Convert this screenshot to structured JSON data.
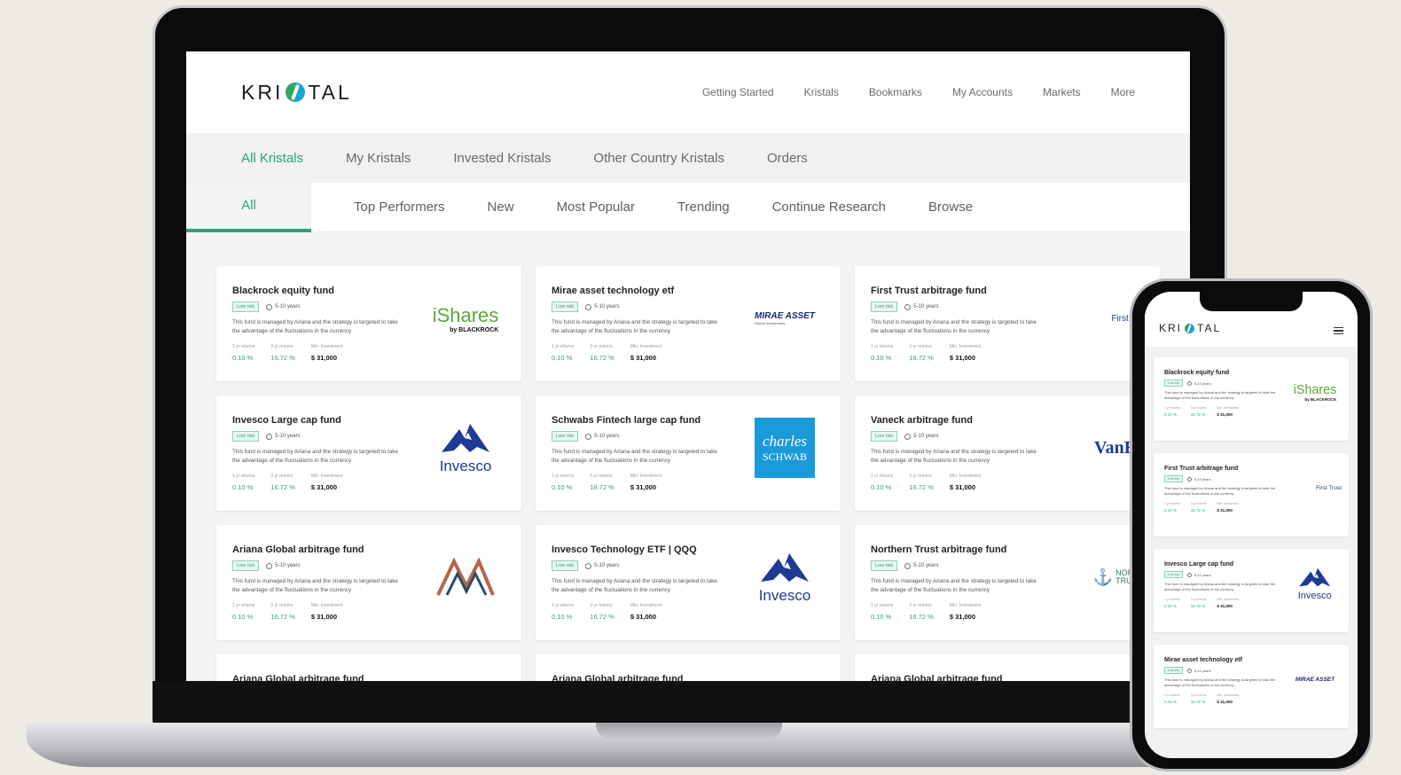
{
  "header": {
    "logo_text_left": "KRI",
    "logo_text_right": "TAL",
    "nav": [
      "Getting Started",
      "Kristals",
      "Bookmarks",
      "My Accounts",
      "Markets",
      "More"
    ]
  },
  "primary_tabs": [
    "All Kristals",
    "My Kristals",
    "Invested Kristals",
    "Other Country Kristals",
    "Orders"
  ],
  "secondary_tabs": [
    "All",
    "Top Performers",
    "New",
    "Most Popular",
    "Trending",
    "Continue Research",
    "Browse"
  ],
  "card_common": {
    "risk": "Low risk",
    "duration": "5-10 years",
    "description": "This fund is managed by Ariana and the strategy is targeted to take the advantage of the fluctuations in the currency",
    "label_1yr": "1 yr returns",
    "label_3yr": "3 yr returns",
    "label_min": "Min. Investment",
    "value_1yr": "0.10 %",
    "value_3yr": "16.72 %",
    "value_min": "$ 31,000"
  },
  "cards": [
    {
      "title": "Blackrock equity fund",
      "brand": "iShares",
      "brand_sub": "by BLACKROCK"
    },
    {
      "title": "Mirae asset technology etf",
      "brand": "MIRAE ASSET",
      "brand_sub": "Global Investments"
    },
    {
      "title": "First Trust arbitrage fund",
      "brand": "First Tru",
      "brand_sub": ""
    },
    {
      "title": "Invesco Large cap fund",
      "brand": "Invesco",
      "brand_sub": ""
    },
    {
      "title": "Schwabs Fintech large cap fund",
      "brand": "charles",
      "brand_sub": "SCHWAB"
    },
    {
      "title": "Vaneck arbitrage fund",
      "brand": "VanEc",
      "brand_sub": ""
    },
    {
      "title": "Ariana Global arbitrage fund",
      "brand": "",
      "brand_sub": ""
    },
    {
      "title": "Invesco Technology ETF | QQQ",
      "brand": "Invesco",
      "brand_sub": ""
    },
    {
      "title": "Northern Trust arbitrage fund",
      "brand": "NORTH",
      "brand_sub": "TRUST"
    },
    {
      "title": "Ariana Global arbitrage fund",
      "brand": "",
      "brand_sub": ""
    },
    {
      "title": "Ariana Global arbitrage fund",
      "brand": "",
      "brand_sub": ""
    },
    {
      "title": "Ariana Global arbitrage fund",
      "brand": "",
      "brand_sub": ""
    }
  ],
  "phone_cards": [
    {
      "title": "Blackrock equity fund",
      "brand": "iShares",
      "brand_sub": "by BLACKROCK"
    },
    {
      "title": "First Trust arbitrage fund",
      "brand": "First Trust",
      "brand_sub": ""
    },
    {
      "title": "Invesco Large cap fund",
      "brand": "Invesco",
      "brand_sub": ""
    },
    {
      "title": "Mirae asset technology etf",
      "brand": "MIRAE ASSET",
      "brand_sub": ""
    }
  ],
  "colors": {
    "accent": "#2ea37a",
    "schwab": "#1a9ad9",
    "invesco": "#1f3a93",
    "ishares": "#5aa83a"
  }
}
